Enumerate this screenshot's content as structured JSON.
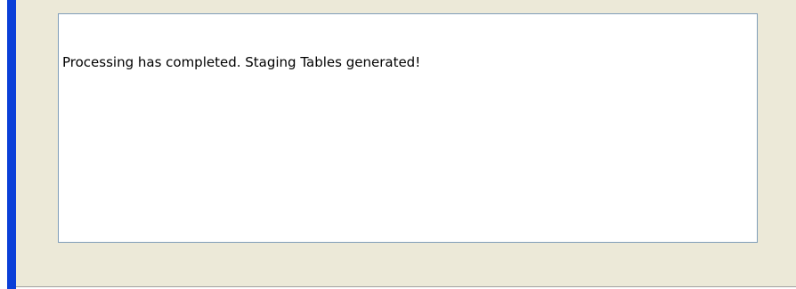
{
  "output": {
    "message": "Processing has completed. Staging Tables generated!"
  },
  "colors": {
    "frame_border": "#0a3fd8",
    "panel_background": "#ece9d8",
    "textbox_border": "#7f9db9",
    "textbox_background": "#ffffff"
  }
}
